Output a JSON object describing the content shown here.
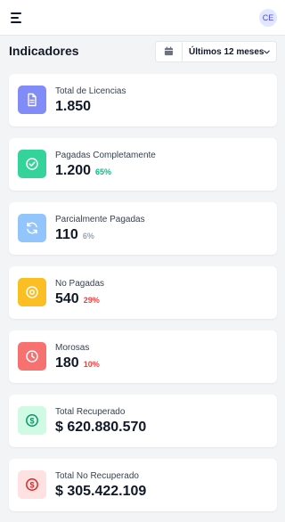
{
  "header": {
    "menu_icon": "hamburger-menu-icon",
    "avatar_initials": "CE"
  },
  "page": {
    "title": "Indicadores"
  },
  "filter": {
    "calendar_icon": "calendar-icon",
    "selected": "Últimos 12 meses",
    "chevron_icon": "chevron-down-icon"
  },
  "cards": [
    {
      "id": "total-licencias",
      "label": "Total de Licencias",
      "value": "1.850",
      "pct": "",
      "icon": "document-icon",
      "icon_bg": "#818cf8",
      "icon_fg": "#ffffff",
      "pct_color": ""
    },
    {
      "id": "pagadas",
      "label": "Pagadas Completamente",
      "value": "1.200",
      "pct": "65%",
      "icon": "check-circle-icon",
      "icon_bg": "#34d399",
      "icon_fg": "#ffffff",
      "pct_color": "#10b981"
    },
    {
      "id": "parcialmente",
      "label": "Parcialmente Pagadas",
      "value": "110",
      "pct": "6%",
      "icon": "refresh-icon",
      "icon_bg": "#93c5fd",
      "icon_fg": "#ffffff",
      "pct_color": "#9ca3af"
    },
    {
      "id": "no-pagadas",
      "label": "No Pagadas",
      "value": "540",
      "pct": "29%",
      "icon": "x-circle-icon",
      "icon_bg": "#fbbf24",
      "icon_fg": "#ffffff",
      "pct_color": "#ef4444"
    },
    {
      "id": "morosas",
      "label": "Morosas",
      "value": "180",
      "pct": "10%",
      "icon": "clock-icon",
      "icon_bg": "#f87171",
      "icon_fg": "#ffffff",
      "pct_color": "#ef4444"
    },
    {
      "id": "recuperado",
      "label": "Total Recuperado",
      "value": "$ 620.880.570",
      "pct": "",
      "icon": "dollar-circle-icon",
      "icon_bg": "#d1fae5",
      "icon_fg": "#059669",
      "pct_color": ""
    },
    {
      "id": "no-recuperado",
      "label": "Total No Recuperado",
      "value": "$ 305.422.109",
      "pct": "",
      "icon": "dollar-circle-icon",
      "icon_bg": "#fee2e2",
      "icon_fg": "#dc2626",
      "pct_color": ""
    }
  ]
}
